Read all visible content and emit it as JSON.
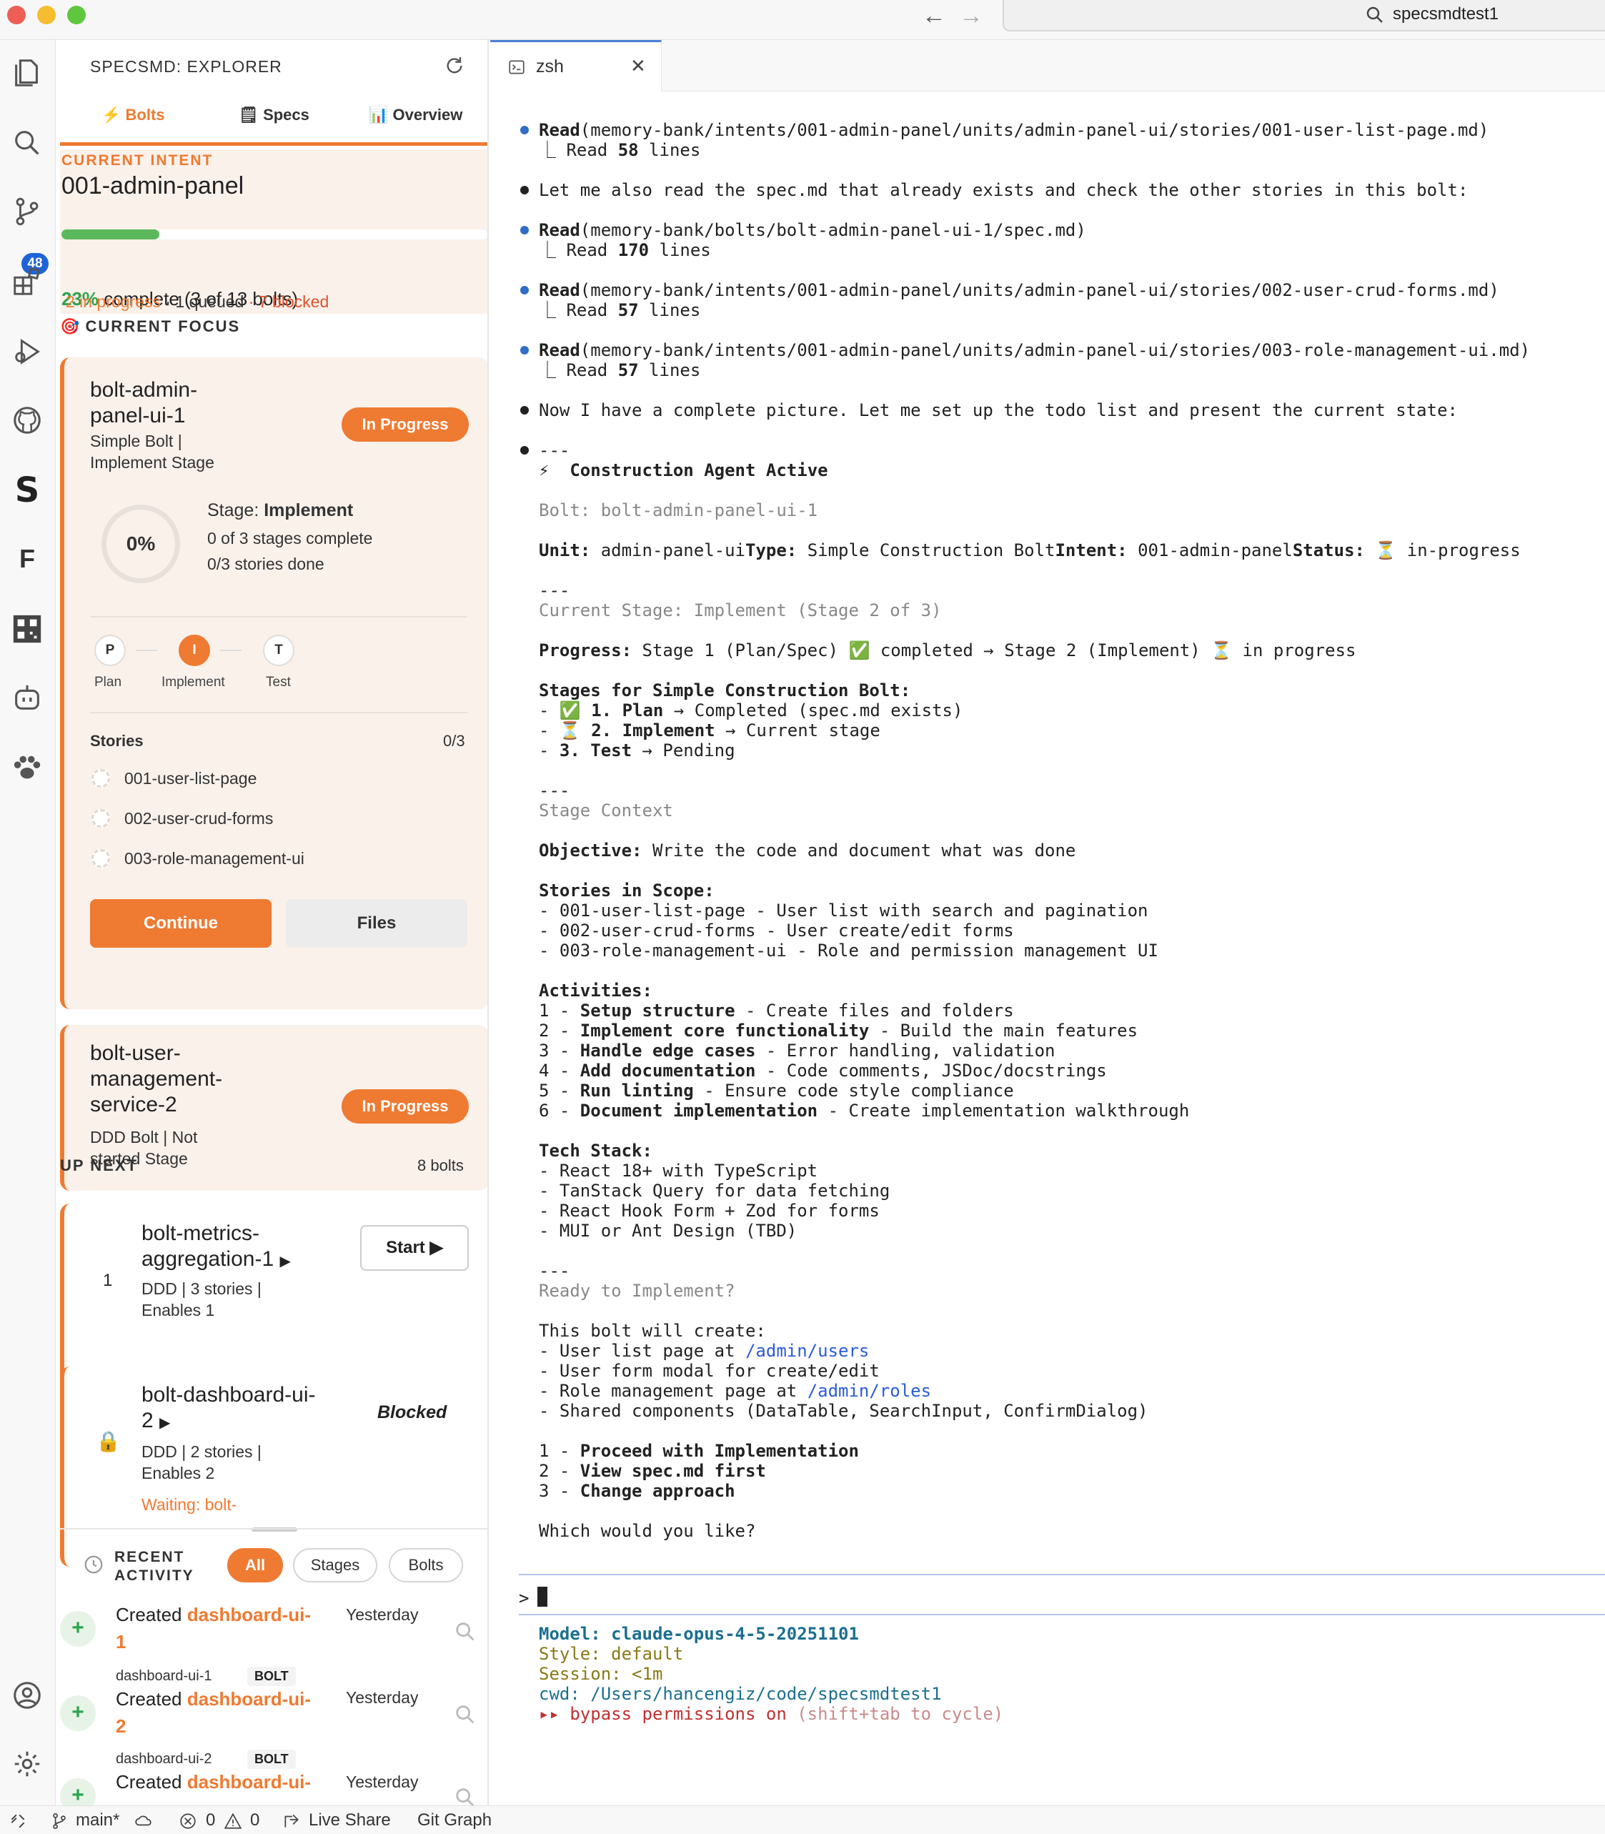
{
  "window": {
    "search_text": "specsmdtest1"
  },
  "activity": {
    "source_control_badge": "48"
  },
  "explorer": {
    "title": "SPECSMD: EXPLORER",
    "tabs": [
      "Bolts",
      "Specs",
      "Overview"
    ],
    "current_intent_label": "CURRENT INTENT",
    "intent_name": "001-admin-panel",
    "progress_pct": "23%",
    "progress_fraction": 0.23,
    "progress_text": "complete (3 of 13 bolts)",
    "in_progress": "2 in progress",
    "queued": "· 1 queued",
    "blocked": "· 7 blocked",
    "current_focus_label": "CURRENT FOCUS",
    "bolt1": {
      "name_l1": "bolt-admin-",
      "name_l2": "panel-ui-1",
      "type_l1": "Simple Bolt |",
      "type_l2": "Implement Stage",
      "status": "In Progress",
      "ring": "0%",
      "stage_prefix": "Stage: ",
      "stage_name": "Implement",
      "stages_complete": "0 of 3 stages complete",
      "stories_done": "0/3 stories done",
      "steps": [
        {
          "letter": "P",
          "label": "Plan"
        },
        {
          "letter": "I",
          "label": "Implement"
        },
        {
          "letter": "T",
          "label": "Test"
        }
      ],
      "stories_label": "Stories",
      "stories_count": "0/3",
      "stories": [
        "001-user-list-page",
        "002-user-crud-forms",
        "003-role-management-ui"
      ],
      "continue": "Continue",
      "files": "Files"
    },
    "bolt2": {
      "name_l1": "bolt-user-",
      "name_l2": "management-",
      "name_l3": "service-2",
      "type_l1": "DDD Bolt | Not",
      "type_l2": "started Stage",
      "status": "In Progress"
    },
    "up_next_label": "UP NEXT",
    "up_next_count": "8 bolts",
    "next1": {
      "num": "1",
      "name_l1": "bolt-metrics-",
      "name_l2": "aggregation-1",
      "arrow": "▶",
      "sub_l1": "DDD | 3 stories |",
      "sub_l2": "Enables 1",
      "start": "Start ▶"
    },
    "next2": {
      "name_l1": "bolt-dashboard-ui-",
      "name_l2": "2",
      "arrow": "▶",
      "status": "Blocked",
      "sub_l1": "DDD | 2 stories |",
      "sub_l2": "Enables 2",
      "waiting": "Waiting: bolt-"
    },
    "recent_l1": "RECENT",
    "recent_l2": "ACTIVITY",
    "filters": [
      "All",
      "Stages",
      "Bolts"
    ],
    "activity": [
      {
        "prefix": "Created ",
        "link_l1": "dashboard-ui-",
        "link_l2": "1",
        "when": "Yesterday",
        "bolt": "dashboard-ui-1",
        "tag": "BOLT"
      },
      {
        "prefix": "Created ",
        "link_l1": "dashboard-ui-",
        "link_l2": "2",
        "when": "Yesterday",
        "bolt": "dashboard-ui-2",
        "tag": "BOLT"
      },
      {
        "prefix": "Created ",
        "link_l1": "dashboard-ui-",
        "link_l2": "",
        "when": "Yesterday"
      }
    ]
  },
  "editor": {
    "tab": "zsh",
    "close": "✕"
  },
  "terminal": {
    "read1_tool": "Read",
    "read1_path": "(memory-bank/intents/001-admin-panel/units/admin-panel-ui/stories/001-user-list-page.md)",
    "read1_res_a": "⎿ Read ",
    "read1_res_n": "58",
    "read1_res_b": " lines",
    "msg1": "Let me also read the spec.md that already exists and check the other stories in this bolt:",
    "read2_tool": "Read",
    "read2_path": "(memory-bank/bolts/bolt-admin-panel-ui-1/spec.md)",
    "read2_res_a": "⎿ Read ",
    "read2_res_n": "170",
    "read2_res_b": " lines",
    "read3_tool": "Read",
    "read3_path": "(memory-bank/intents/001-admin-panel/units/admin-panel-ui/stories/002-user-crud-forms.md)",
    "read3_res_a": "⎿ Read ",
    "read3_res_n": "57",
    "read3_res_b": " lines",
    "read4_tool": "Read",
    "read4_path": "(memory-bank/intents/001-admin-panel/units/admin-panel-ui/stories/003-role-management-ui.md)",
    "read4_res_a": "⎿ Read ",
    "read4_res_n": "57",
    "read4_res_b": " lines",
    "msg2": "Now I have a complete picture. Let me set up the todo list and present the current state:",
    "sep": "---",
    "agent_icon": "⚡",
    "agent": "Construction Agent Active",
    "bolt_line": "Bolt: bolt-admin-panel-ui-1",
    "unit_k": "Unit:",
    "unit_v": " admin-panel-ui",
    "type_k": "Type:",
    "type_v": " Simple Construction Bolt",
    "intent_k": "Intent:",
    "intent_v": " 001-admin-panel",
    "status_k": "Status:",
    "status_v": " ⏳ in-progress",
    "current_stage": "Current Stage: Implement (Stage 2 of 3)",
    "progress_k": "Progress:",
    "progress_v": " Stage 1 (Plan/Spec) ✅ completed → Stage 2 (Implement) ⏳ in progress",
    "stages_h": "Stages for Simple Construction Bolt:",
    "stage1_a": "- ✅ ",
    "stage1_b": "1. Plan",
    "stage1_c": " → Completed (spec.md exists)",
    "stage2_a": "- ⏳ ",
    "stage2_b": "2. Implement",
    "stage2_c": " → Current stage",
    "stage3_a": "- ",
    "stage3_b": "3. Test",
    "stage3_c": " → Pending",
    "stage_context": "Stage Context",
    "objective_k": "Objective:",
    "objective_v": " Write the code and document what was done",
    "stories_h": "Stories in Scope:",
    "story1": "- 001-user-list-page - User list with search and pagination",
    "story2": "- 002-user-crud-forms - User create/edit forms",
    "story3": "- 003-role-management-ui - Role and permission management UI",
    "activities_h": "Activities:",
    "acts": [
      {
        "n": "1 - ",
        "k": "Setup structure",
        "v": " - Create files and folders"
      },
      {
        "n": "2 - ",
        "k": "Implement core functionality",
        "v": " - Build the main features"
      },
      {
        "n": "3 - ",
        "k": "Handle edge cases",
        "v": " - Error handling, validation"
      },
      {
        "n": "4 - ",
        "k": "Add documentation",
        "v": " - Code comments, JSDoc/docstrings"
      },
      {
        "n": "5 - ",
        "k": "Run linting",
        "v": " - Ensure code style compliance"
      },
      {
        "n": "6 - ",
        "k": "Document implementation",
        "v": " - Create implementation walkthrough"
      }
    ],
    "tech_h": "Tech Stack:",
    "tech": [
      "- React 18+ with TypeScript",
      "- TanStack Query for data fetching",
      "- React Hook Form + Zod for forms",
      "- MUI or Ant Design (TBD)"
    ],
    "ready": "Ready to Implement?",
    "creates_h": "This bolt will create:",
    "c1_a": "- User list page at ",
    "c1_link": "/admin/users",
    "c2": "- User form modal for create/edit",
    "c3_a": "- Role management page at ",
    "c3_link": "/admin/roles",
    "c4": "- Shared components (DataTable, SearchInput, ConfirmDialog)",
    "opts": [
      {
        "n": "1 - ",
        "k": "Proceed with Implementation"
      },
      {
        "n": "2 - ",
        "k": "View spec.md first"
      },
      {
        "n": "3 - ",
        "k": "Change approach"
      }
    ],
    "question": "Which would you like?",
    "prompt": ">",
    "model": "Model: claude-opus-4-5-20251101",
    "style": "Style: default",
    "session": "Session: <1m",
    "cwd": "cwd: /Users/hancengiz/code/specsmdtest1",
    "bypass_a": "▸▸ bypass permissions on",
    "bypass_b": " (shift+tab to cycle)"
  },
  "status": {
    "branch": "main*",
    "errors": "0",
    "warnings": "0",
    "live_share": "Live Share",
    "git_graph": "Git Graph"
  }
}
